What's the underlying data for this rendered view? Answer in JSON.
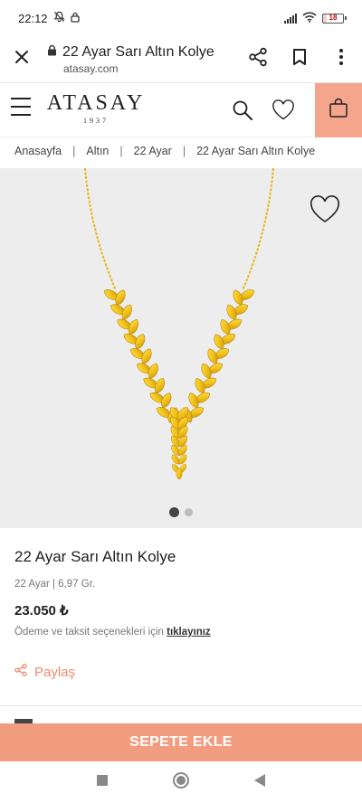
{
  "status_bar": {
    "time": "22:12",
    "battery": "18"
  },
  "browser": {
    "page_title": "22 Ayar Sarı Altın Kolye",
    "host": "atasay.com"
  },
  "site": {
    "logo_word": "ATASAY",
    "logo_year": "1937"
  },
  "breadcrumb": [
    "Anasayfa",
    "Altın",
    "22 Ayar",
    "22 Ayar Sarı Altın Kolye"
  ],
  "breadcrumb_separator": "|",
  "gallery": {
    "image_count": 2,
    "active_index": 0
  },
  "product": {
    "title": "22 Ayar Sarı Altın Kolye",
    "meta": "22 Ayar | 6,97 Gr.",
    "price": "23.050 ₺",
    "payment_text": "Ödeme ve taksit seçenekleri için",
    "payment_link": "tıklayınız",
    "share_label": "Paylaş"
  },
  "add_to_cart_label": "SEPETE EKLE",
  "colors": {
    "accent": "#f29c80",
    "cart_bg": "#f4a58c",
    "share": "#ee8a6b",
    "gold": "#f2c21a"
  },
  "icons": {
    "close": "close-icon",
    "lock": "lock-icon",
    "share": "share-icon",
    "bookmark": "bookmark-icon",
    "more": "more-vert-icon",
    "menu": "hamburger-icon",
    "search": "search-icon",
    "favorite": "heart-icon",
    "cart": "shopping-bag-icon"
  }
}
